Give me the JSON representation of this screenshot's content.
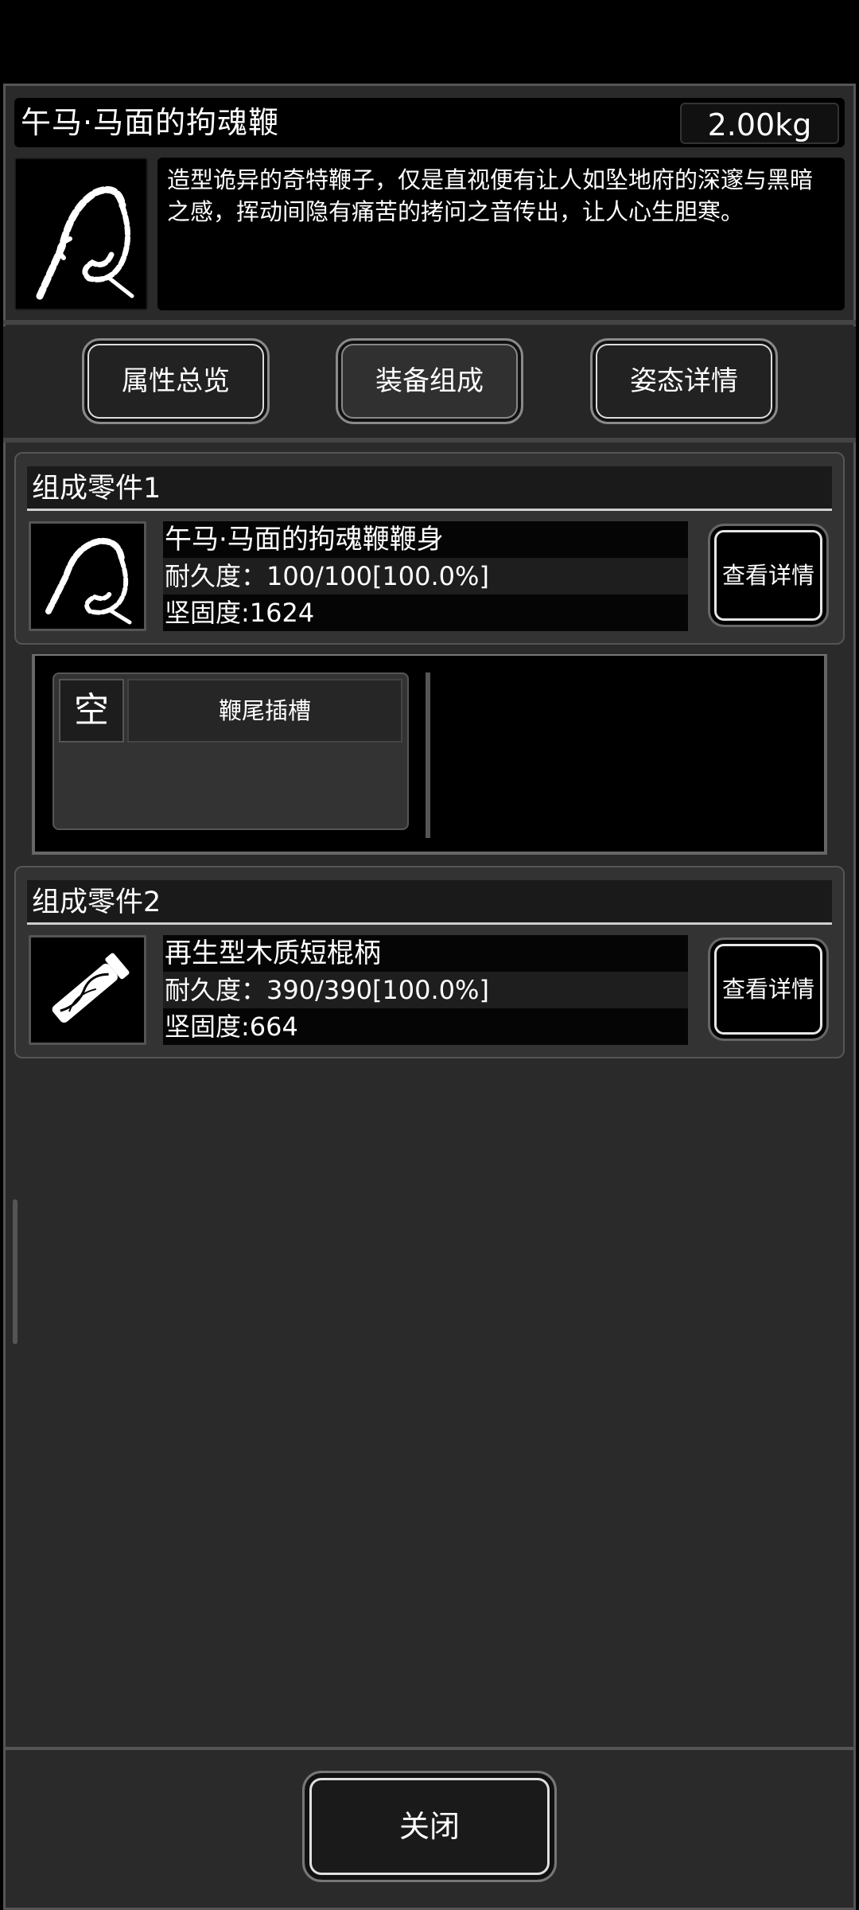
{
  "item": {
    "name": "午马·马面的拘魂鞭",
    "weight": "2.00kg",
    "description": "造型诡异的奇特鞭子，仅是直视便有让人如坠地府的深邃与黑暗之感，挥动间隐有痛苦的拷问之音传出，让人心生胆寒。",
    "icon": "whip-icon"
  },
  "tabs": [
    {
      "label": "属性总览",
      "active": false
    },
    {
      "label": "装备组成",
      "active": true
    },
    {
      "label": "姿态详情",
      "active": false
    }
  ],
  "components": [
    {
      "title": "组成零件1",
      "name": "午马·马面的拘魂鞭鞭身",
      "durability": "耐久度：100/100[100.0%]",
      "hardness": "坚固度:1624",
      "icon": "whip-body-icon",
      "button": "查看详情"
    },
    {
      "title": "组成零件2",
      "name": "再生型木质短棍柄",
      "durability": "耐久度：390/390[100.0%]",
      "hardness": "坚固度:664",
      "icon": "wooden-handle-icon",
      "button": "查看详情"
    }
  ],
  "slot": {
    "status": "空",
    "label": "鞭尾插槽"
  },
  "footer": {
    "close": "关闭"
  }
}
